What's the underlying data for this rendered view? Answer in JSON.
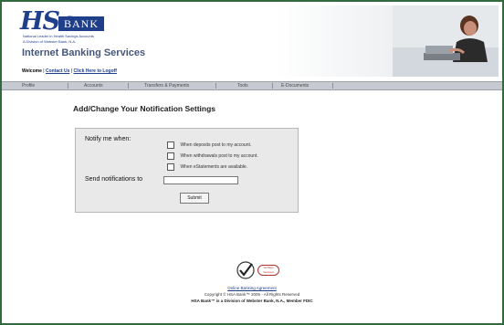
{
  "header": {
    "logo_hsa": "HSa",
    "logo_bank": "BANK",
    "logo_tagline_1": "National Leader in Health Savings Accounts",
    "logo_tagline_2": "A Division of Webster Bank, N.A.",
    "service_title": "Internet Banking Services",
    "welcome_label": "Welcome",
    "contact_link": "Contact Us",
    "logoff_link": "Click Here to Logoff",
    "separator": "|"
  },
  "nav": {
    "items": [
      "Profile",
      "Accounts",
      "Transfers & Payments",
      "Tools",
      "E-Documents"
    ]
  },
  "main": {
    "page_title": "Add/Change Your Notification Settings",
    "notify_label": "Notify me when:",
    "options": [
      "When deposits post to my account.",
      "When withdrawals post to my account.",
      "When eStatements are available."
    ],
    "send_label": "Send notifications to",
    "send_value": "",
    "submit_label": "Submit"
  },
  "footer": {
    "seal_text": "VeriSign Secured",
    "agreement_link": "Online Banking Agreement",
    "copyright": "Copyright © HSA Bank™ 2005 - All Rights Reserved",
    "bank_line": "HSA Bank™ is a Division of Webster Bank, N.A., Member FDIC"
  },
  "colors": {
    "frame": "#2f6b3e",
    "brand_blue": "#1f3f8a",
    "nav_bg": "#c7cbd1",
    "panel_bg": "#e9e9e9"
  }
}
